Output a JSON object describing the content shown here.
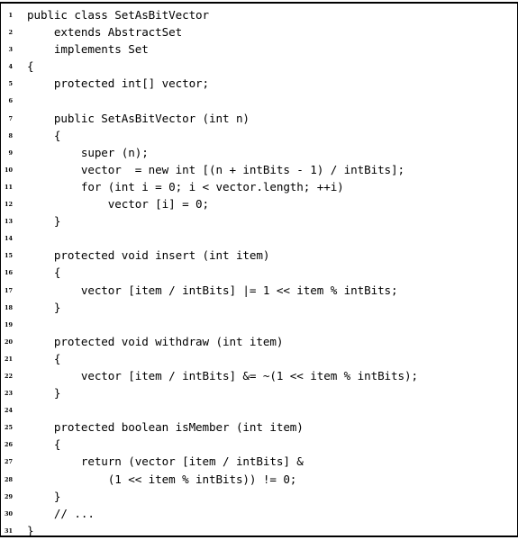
{
  "listing": {
    "lines": [
      {
        "num": "1",
        "text": "public class SetAsBitVector"
      },
      {
        "num": "2",
        "text": "    extends AbstractSet"
      },
      {
        "num": "3",
        "text": "    implements Set"
      },
      {
        "num": "4",
        "text": "{"
      },
      {
        "num": "5",
        "text": "    protected int[] vector;"
      },
      {
        "num": "6",
        "text": ""
      },
      {
        "num": "7",
        "text": "    public SetAsBitVector (int n)"
      },
      {
        "num": "8",
        "text": "    {"
      },
      {
        "num": "9",
        "text": "        super (n);"
      },
      {
        "num": "10",
        "text": "        vector  = new int [(n + intBits - 1) / intBits];"
      },
      {
        "num": "11",
        "text": "        for (int i = 0; i < vector.length; ++i)"
      },
      {
        "num": "12",
        "text": "            vector [i] = 0;"
      },
      {
        "num": "13",
        "text": "    }"
      },
      {
        "num": "14",
        "text": ""
      },
      {
        "num": "15",
        "text": "    protected void insert (int item)"
      },
      {
        "num": "16",
        "text": "    {"
      },
      {
        "num": "17",
        "text": "        vector [item / intBits] |= 1 << item % intBits;"
      },
      {
        "num": "18",
        "text": "    }"
      },
      {
        "num": "19",
        "text": ""
      },
      {
        "num": "20",
        "text": "    protected void withdraw (int item)"
      },
      {
        "num": "21",
        "text": "    {"
      },
      {
        "num": "22",
        "text": "        vector [item / intBits] &= ~(1 << item % intBits);"
      },
      {
        "num": "23",
        "text": "    }"
      },
      {
        "num": "24",
        "text": ""
      },
      {
        "num": "25",
        "text": "    protected boolean isMember (int item)"
      },
      {
        "num": "26",
        "text": "    {"
      },
      {
        "num": "27",
        "text": "        return (vector [item / intBits] &"
      },
      {
        "num": "28",
        "text": "            (1 << item % intBits)) != 0;"
      },
      {
        "num": "29",
        "text": "    }"
      },
      {
        "num": "30",
        "text": "    // ..."
      },
      {
        "num": "31",
        "text": "}"
      }
    ]
  }
}
